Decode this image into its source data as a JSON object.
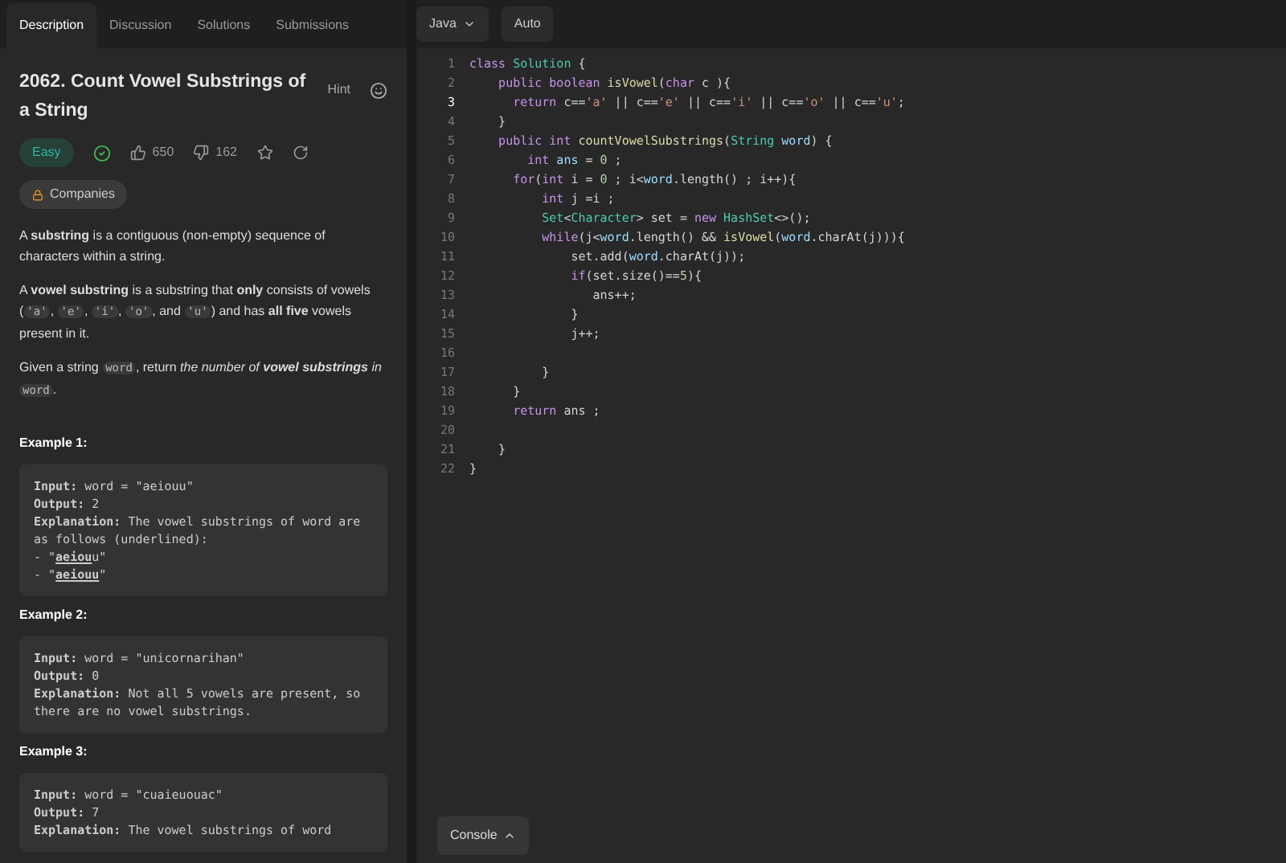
{
  "tabs": [
    {
      "label": "Description",
      "selected": true
    },
    {
      "label": "Discussion",
      "selected": false
    },
    {
      "label": "Solutions",
      "selected": false
    },
    {
      "label": "Submissions",
      "selected": false
    }
  ],
  "editor_toolbar": {
    "language": "Java",
    "mode": "Auto"
  },
  "problem": {
    "title": "2062. Count Vowel Substrings of a String",
    "hint": "Hint",
    "difficulty": "Easy",
    "solved": true,
    "likes": "650",
    "dislikes": "162",
    "companies": "Companies"
  },
  "description": [
    {
      "parts": [
        {
          "text": "A **substring** is a contiguous (non-empty) sequence of characters within a string.",
          "kind": "text"
        }
      ]
    },
    {
      "parts": [
        {
          "text": "A **vowel substring** is a substring that **only** consists of vowels (",
          "kind": "text"
        },
        {
          "text": "'a'",
          "kind": "code"
        },
        {
          "text": ", ",
          "kind": "text"
        },
        {
          "text": "'e'",
          "kind": "code"
        },
        {
          "text": ", ",
          "kind": "text"
        },
        {
          "text": "'i'",
          "kind": "code"
        },
        {
          "text": ", ",
          "kind": "text"
        },
        {
          "text": "'o'",
          "kind": "code"
        },
        {
          "text": ", and ",
          "kind": "text"
        },
        {
          "text": "'u'",
          "kind": "code"
        },
        {
          "text": ") and has **all five** vowels present in it.",
          "kind": "text"
        }
      ]
    },
    {
      "parts": [
        {
          "text": "Given a string ",
          "kind": "text"
        },
        {
          "text": "word",
          "kind": "code"
        },
        {
          "text": ", return *the number of* ",
          "kind": "text"
        },
        {
          "text": "vowel substrings",
          "kind": "bold-italic"
        },
        {
          "text": " *in* ",
          "kind": "text"
        },
        {
          "text": "word",
          "kind": "code"
        },
        {
          "text": ".",
          "kind": "text"
        }
      ]
    }
  ],
  "examples": [
    {
      "title": "Example 1:",
      "lines": [
        {
          "parts": [
            {
              "text": "**Input:** word = \"aeiouu\"",
              "kind": "plain"
            }
          ]
        },
        {
          "parts": [
            {
              "text": "**Output:** 2",
              "kind": "plain"
            }
          ]
        },
        {
          "parts": [
            {
              "text": "**Explanation:** The vowel substrings of word are as follows (underlined):",
              "kind": "plain"
            }
          ]
        },
        {
          "parts": [
            {
              "text": "- \"",
              "kind": "plain"
            },
            {
              "text": "**aeiou**",
              "kind": "underline"
            },
            {
              "text": "u\"",
              "kind": "plain"
            }
          ]
        },
        {
          "parts": [
            {
              "text": "- \"",
              "kind": "plain"
            },
            {
              "text": "**aeiouu**",
              "kind": "underline"
            },
            {
              "text": "\"",
              "kind": "plain"
            }
          ]
        }
      ]
    },
    {
      "title": "Example 2:",
      "lines": [
        {
          "parts": [
            {
              "text": "**Input:** word = \"unicornarihan\"",
              "kind": "plain"
            }
          ]
        },
        {
          "parts": [
            {
              "text": "**Output:** 0",
              "kind": "plain"
            }
          ]
        },
        {
          "parts": [
            {
              "text": "**Explanation:** Not all 5 vowels are present, so there are no vowel substrings.",
              "kind": "plain"
            }
          ]
        }
      ]
    },
    {
      "title": "Example 3:",
      "lines": [
        {
          "parts": [
            {
              "text": "**Input:** word = \"cuaieuouac\"",
              "kind": "plain"
            }
          ]
        },
        {
          "parts": [
            {
              "text": "**Output:** 7",
              "kind": "plain"
            }
          ]
        },
        {
          "parts": [
            {
              "text": "**Explanation:** The vowel substrings of word",
              "kind": "plain"
            }
          ]
        }
      ]
    }
  ],
  "code_lines": [
    {
      "number": "1",
      "active": false,
      "tokens": [
        {
          "kind": "kw",
          "text": "class "
        },
        {
          "kind": "type",
          "text": "Solution"
        },
        {
          "kind": "plain",
          "text": " {"
        }
      ]
    },
    {
      "number": "2",
      "active": false,
      "tokens": [
        {
          "kind": "kw",
          "text": "    public boolean "
        },
        {
          "kind": "fn",
          "text": "isVowel"
        },
        {
          "kind": "plain",
          "text": "("
        },
        {
          "kind": "kw",
          "text": "char"
        },
        {
          "kind": "plain",
          "text": " c ){"
        }
      ]
    },
    {
      "number": "3",
      "active": true,
      "tokens": [
        {
          "kind": "kw",
          "text": "      return"
        },
        {
          "kind": "plain",
          "text": " c=="
        },
        {
          "kind": "str",
          "text": "'a'"
        },
        {
          "kind": "plain",
          "text": " || c=="
        },
        {
          "kind": "str",
          "text": "'e'"
        },
        {
          "kind": "plain",
          "text": " || c=="
        },
        {
          "kind": "str",
          "text": "'i'"
        },
        {
          "kind": "plain",
          "text": " || c=="
        },
        {
          "kind": "str",
          "text": "'o'"
        },
        {
          "kind": "plain",
          "text": " || c=="
        },
        {
          "kind": "str",
          "text": "'u'"
        },
        {
          "kind": "plain",
          "text": ";"
        }
      ]
    },
    {
      "number": "4",
      "active": false,
      "tokens": [
        {
          "kind": "plain",
          "text": "    }"
        }
      ]
    },
    {
      "number": "5",
      "active": false,
      "tokens": [
        {
          "kind": "kw",
          "text": "    public int "
        },
        {
          "kind": "fn",
          "text": "countVowelSubstrings"
        },
        {
          "kind": "plain",
          "text": "("
        },
        {
          "kind": "type",
          "text": "String"
        },
        {
          "kind": "var",
          "text": " word"
        },
        {
          "kind": "plain",
          "text": ") {"
        }
      ]
    },
    {
      "number": "6",
      "active": false,
      "tokens": [
        {
          "kind": "kw",
          "text": "        int"
        },
        {
          "kind": "var",
          "text": " ans"
        },
        {
          "kind": "plain",
          "text": " = "
        },
        {
          "kind": "num",
          "text": "0"
        },
        {
          "kind": "plain",
          "text": " ;"
        }
      ]
    },
    {
      "number": "7",
      "active": false,
      "tokens": [
        {
          "kind": "kw",
          "text": "      for"
        },
        {
          "kind": "plain",
          "text": "("
        },
        {
          "kind": "kw",
          "text": "int"
        },
        {
          "kind": "plain",
          "text": " i = "
        },
        {
          "kind": "num",
          "text": "0"
        },
        {
          "kind": "plain",
          "text": " ; i<"
        },
        {
          "kind": "var",
          "text": "word"
        },
        {
          "kind": "plain",
          "text": ".length() ; i++){"
        }
      ]
    },
    {
      "number": "8",
      "active": false,
      "tokens": [
        {
          "kind": "kw",
          "text": "          int"
        },
        {
          "kind": "plain",
          "text": " j =i ;"
        }
      ]
    },
    {
      "number": "9",
      "active": false,
      "tokens": [
        {
          "kind": "type",
          "text": "          Set"
        },
        {
          "kind": "plain",
          "text": "<"
        },
        {
          "kind": "type",
          "text": "Character"
        },
        {
          "kind": "plain",
          "text": "> set = "
        },
        {
          "kind": "kw",
          "text": "new "
        },
        {
          "kind": "type",
          "text": "HashSet"
        },
        {
          "kind": "plain",
          "text": "<>();"
        }
      ]
    },
    {
      "number": "10",
      "active": false,
      "tokens": [
        {
          "kind": "kw",
          "text": "          while"
        },
        {
          "kind": "plain",
          "text": "(j<"
        },
        {
          "kind": "var",
          "text": "word"
        },
        {
          "kind": "plain",
          "text": ".length() && "
        },
        {
          "kind": "fn",
          "text": "isVowel"
        },
        {
          "kind": "plain",
          "text": "("
        },
        {
          "kind": "var",
          "text": "word"
        },
        {
          "kind": "plain",
          "text": ".charAt(j))){"
        }
      ]
    },
    {
      "number": "11",
      "active": false,
      "tokens": [
        {
          "kind": "plain",
          "text": "              set.add("
        },
        {
          "kind": "var",
          "text": "word"
        },
        {
          "kind": "plain",
          "text": ".charAt(j));"
        }
      ]
    },
    {
      "number": "12",
      "active": false,
      "tokens": [
        {
          "kind": "kw",
          "text": "              if"
        },
        {
          "kind": "plain",
          "text": "(set.size()=="
        },
        {
          "kind": "num",
          "text": "5"
        },
        {
          "kind": "plain",
          "text": "){"
        }
      ]
    },
    {
      "number": "13",
      "active": false,
      "tokens": [
        {
          "kind": "plain",
          "text": "                 ans++;"
        }
      ]
    },
    {
      "number": "14",
      "active": false,
      "tokens": [
        {
          "kind": "plain",
          "text": "              }"
        }
      ]
    },
    {
      "number": "15",
      "active": false,
      "tokens": [
        {
          "kind": "plain",
          "text": "              j++;"
        }
      ]
    },
    {
      "number": "16",
      "active": false
    },
    {
      "number": "17",
      "active": false,
      "tokens": [
        {
          "kind": "plain",
          "text": "          }"
        }
      ]
    },
    {
      "number": "18",
      "active": false,
      "tokens": [
        {
          "kind": "plain",
          "text": "      }"
        }
      ]
    },
    {
      "number": "19",
      "active": false,
      "tokens": [
        {
          "kind": "kw",
          "text": "      return"
        },
        {
          "kind": "plain",
          "text": " ans ;"
        }
      ]
    },
    {
      "number": "20",
      "active": false
    },
    {
      "number": "21",
      "active": false,
      "tokens": [
        {
          "kind": "plain",
          "text": "    }"
        }
      ]
    },
    {
      "number": "22",
      "active": false,
      "tokens": [
        {
          "kind": "plain",
          "text": "}"
        }
      ]
    }
  ],
  "console": {
    "label": "Console"
  }
}
